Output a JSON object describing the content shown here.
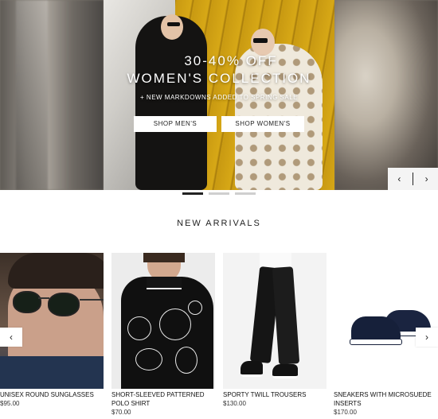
{
  "hero": {
    "headline": "30-40% OFF",
    "subhead": "WOMEN'S COLLECTION",
    "tagline": "+ NEW MARKDOWNS ADDED TO SPRING SALE",
    "buttons": {
      "shop_men": "SHOP MEN'S",
      "shop_women": "SHOP WOMEN'S"
    },
    "nav": {
      "prev_icon": "‹",
      "next_icon": "›"
    },
    "slides": {
      "total": 3,
      "active": 1
    }
  },
  "section": {
    "title": "NEW ARRIVALS"
  },
  "carousel": {
    "prev_icon": "‹",
    "next_icon": "›"
  },
  "products": [
    {
      "name": "UNISEX ROUND SUNGLASSES",
      "price": "$95.00",
      "icon": "sunglasses-image"
    },
    {
      "name": "SHORT-SLEEVED PATTERNED POLO SHIRT",
      "price": "$70.00",
      "icon": "polo-shirt-image"
    },
    {
      "name": "SPORTY TWILL TROUSERS",
      "price": "$130.00",
      "icon": "trousers-image"
    },
    {
      "name": "SNEAKERS WITH MICROSUEDE INSERTS",
      "price": "$170.00",
      "icon": "sneakers-image"
    }
  ],
  "colors": {
    "text": "#111111",
    "accent_dot": "#222222",
    "inactive_dot": "#cfcfcf",
    "button_bg": "#ffffff"
  }
}
